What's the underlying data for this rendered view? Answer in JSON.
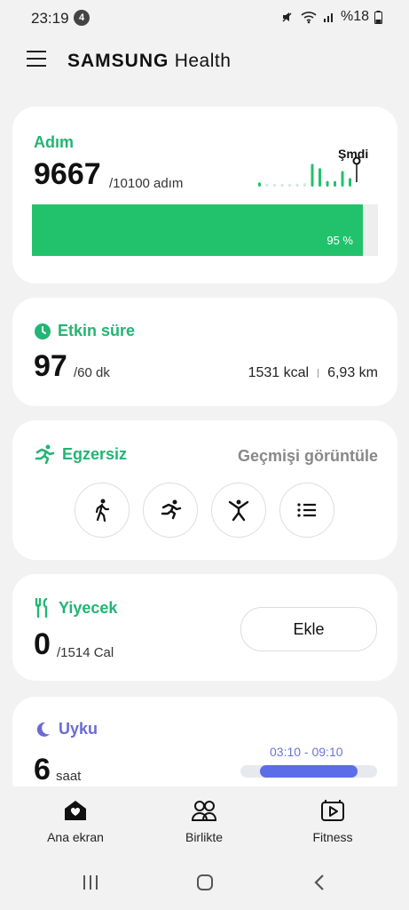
{
  "status": {
    "time": "23:19",
    "notif_count": "4",
    "battery": "%18"
  },
  "header": {
    "brand_bold": "SAMSUNG",
    "brand_light": "Health"
  },
  "steps": {
    "title": "Adım",
    "value": "9667",
    "goal": "/10100 adım",
    "now_label": "Şmdi",
    "percent_text": "95 %",
    "progress": 0.957,
    "spark_bars": [
      0.15,
      0.1,
      0.1,
      0.1,
      0.1,
      0.1,
      0.12,
      0.8,
      0.65,
      0.2,
      0.2,
      0.55,
      0.3
    ]
  },
  "active": {
    "title": "Etkin süre",
    "value": "97",
    "goal": "/60 dk",
    "kcal": "1531 kcal",
    "distance": "6,93 km"
  },
  "exercise": {
    "title": "Egzersiz",
    "history": "Geçmişi görüntüle",
    "buttons": [
      "walk-icon",
      "run-icon",
      "workout-icon",
      "list-icon"
    ]
  },
  "food": {
    "title": "Yiyecek",
    "value": "0",
    "goal": "/1514 Cal",
    "add_label": "Ekle"
  },
  "sleep": {
    "title": "Uyku",
    "value": "6",
    "unit": "saat",
    "range": "03:10 - 09:10",
    "progress": 0.77
  },
  "nav": {
    "home": "Ana ekran",
    "together": "Birlikte",
    "fitness": "Fitness"
  },
  "colors": {
    "green": "#21c26b",
    "sleep": "#5b6ee8"
  }
}
